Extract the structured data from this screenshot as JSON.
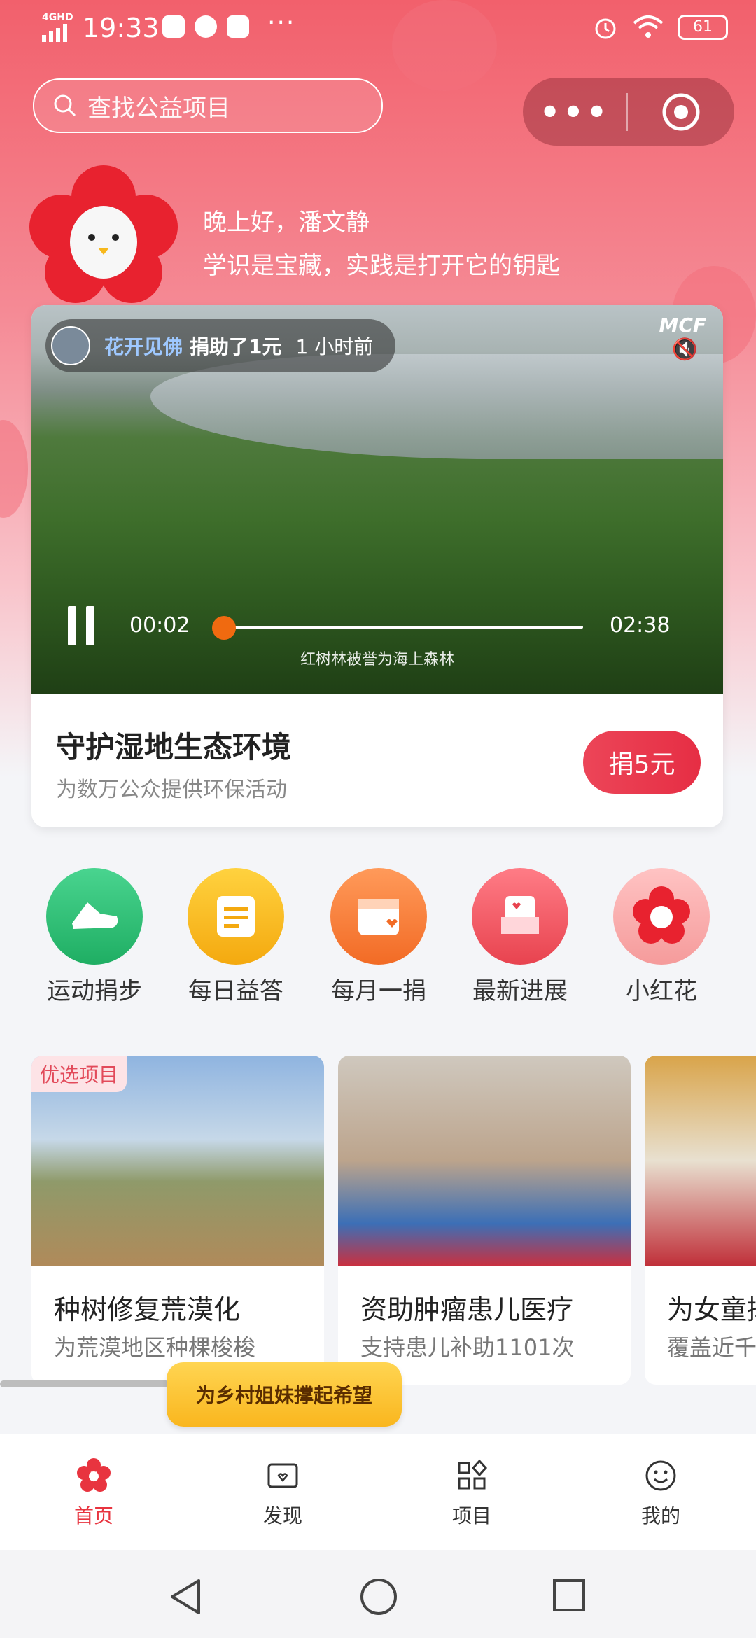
{
  "status_bar": {
    "network": "4GHD",
    "time": "19:33",
    "more": "···",
    "battery": "61"
  },
  "header": {
    "search_placeholder": "查找公益项目",
    "capsule_more": "•••"
  },
  "greeting": {
    "hello": "晚上好，潘文静",
    "motto": "学识是宝藏，实践是打开它的钥匙"
  },
  "featured": {
    "donor_name": "花开见佛",
    "donor_action": "捐助了1元",
    "donor_time": "1 小时前",
    "watermark": "MCF",
    "current_time": "00:02",
    "duration": "02:38",
    "progress_fraction": 0.013,
    "caption": "红树林被誉为海上森林",
    "title": "守护湿地生态环境",
    "subtitle": "为数万公众提供环保活动",
    "donate_label": "捐5元"
  },
  "quick_entries": [
    {
      "label": "运动捐步",
      "icon": "sneaker-icon",
      "color": "#2ec27e"
    },
    {
      "label": "每日益答",
      "icon": "quiz-card-icon",
      "color": "#f7b81c"
    },
    {
      "label": "每月一捐",
      "icon": "calendar-heart-icon",
      "color": "#f7773a"
    },
    {
      "label": "最新进展",
      "icon": "inbox-heart-icon",
      "color": "#ef5664"
    },
    {
      "label": "小红花",
      "icon": "red-flower-icon",
      "color": "#f7a8a8"
    }
  ],
  "projects": [
    {
      "badge": "优选项目",
      "title": "种树修复荒漠化",
      "subtitle": "为荒漠地区种棵梭梭"
    },
    {
      "title": "资助肿瘤患儿医疗",
      "subtitle": "支持患儿补助1101次"
    },
    {
      "title": "为女童撑",
      "subtitle": "覆盖近千"
    }
  ],
  "tooltip": "为乡村姐妹撑起希望",
  "tabs": [
    {
      "label": "首页",
      "active": true
    },
    {
      "label": "发现"
    },
    {
      "label": "项目"
    },
    {
      "label": "我的"
    }
  ],
  "colors": {
    "brand": "#e8343f",
    "accent": "#f06a10"
  }
}
